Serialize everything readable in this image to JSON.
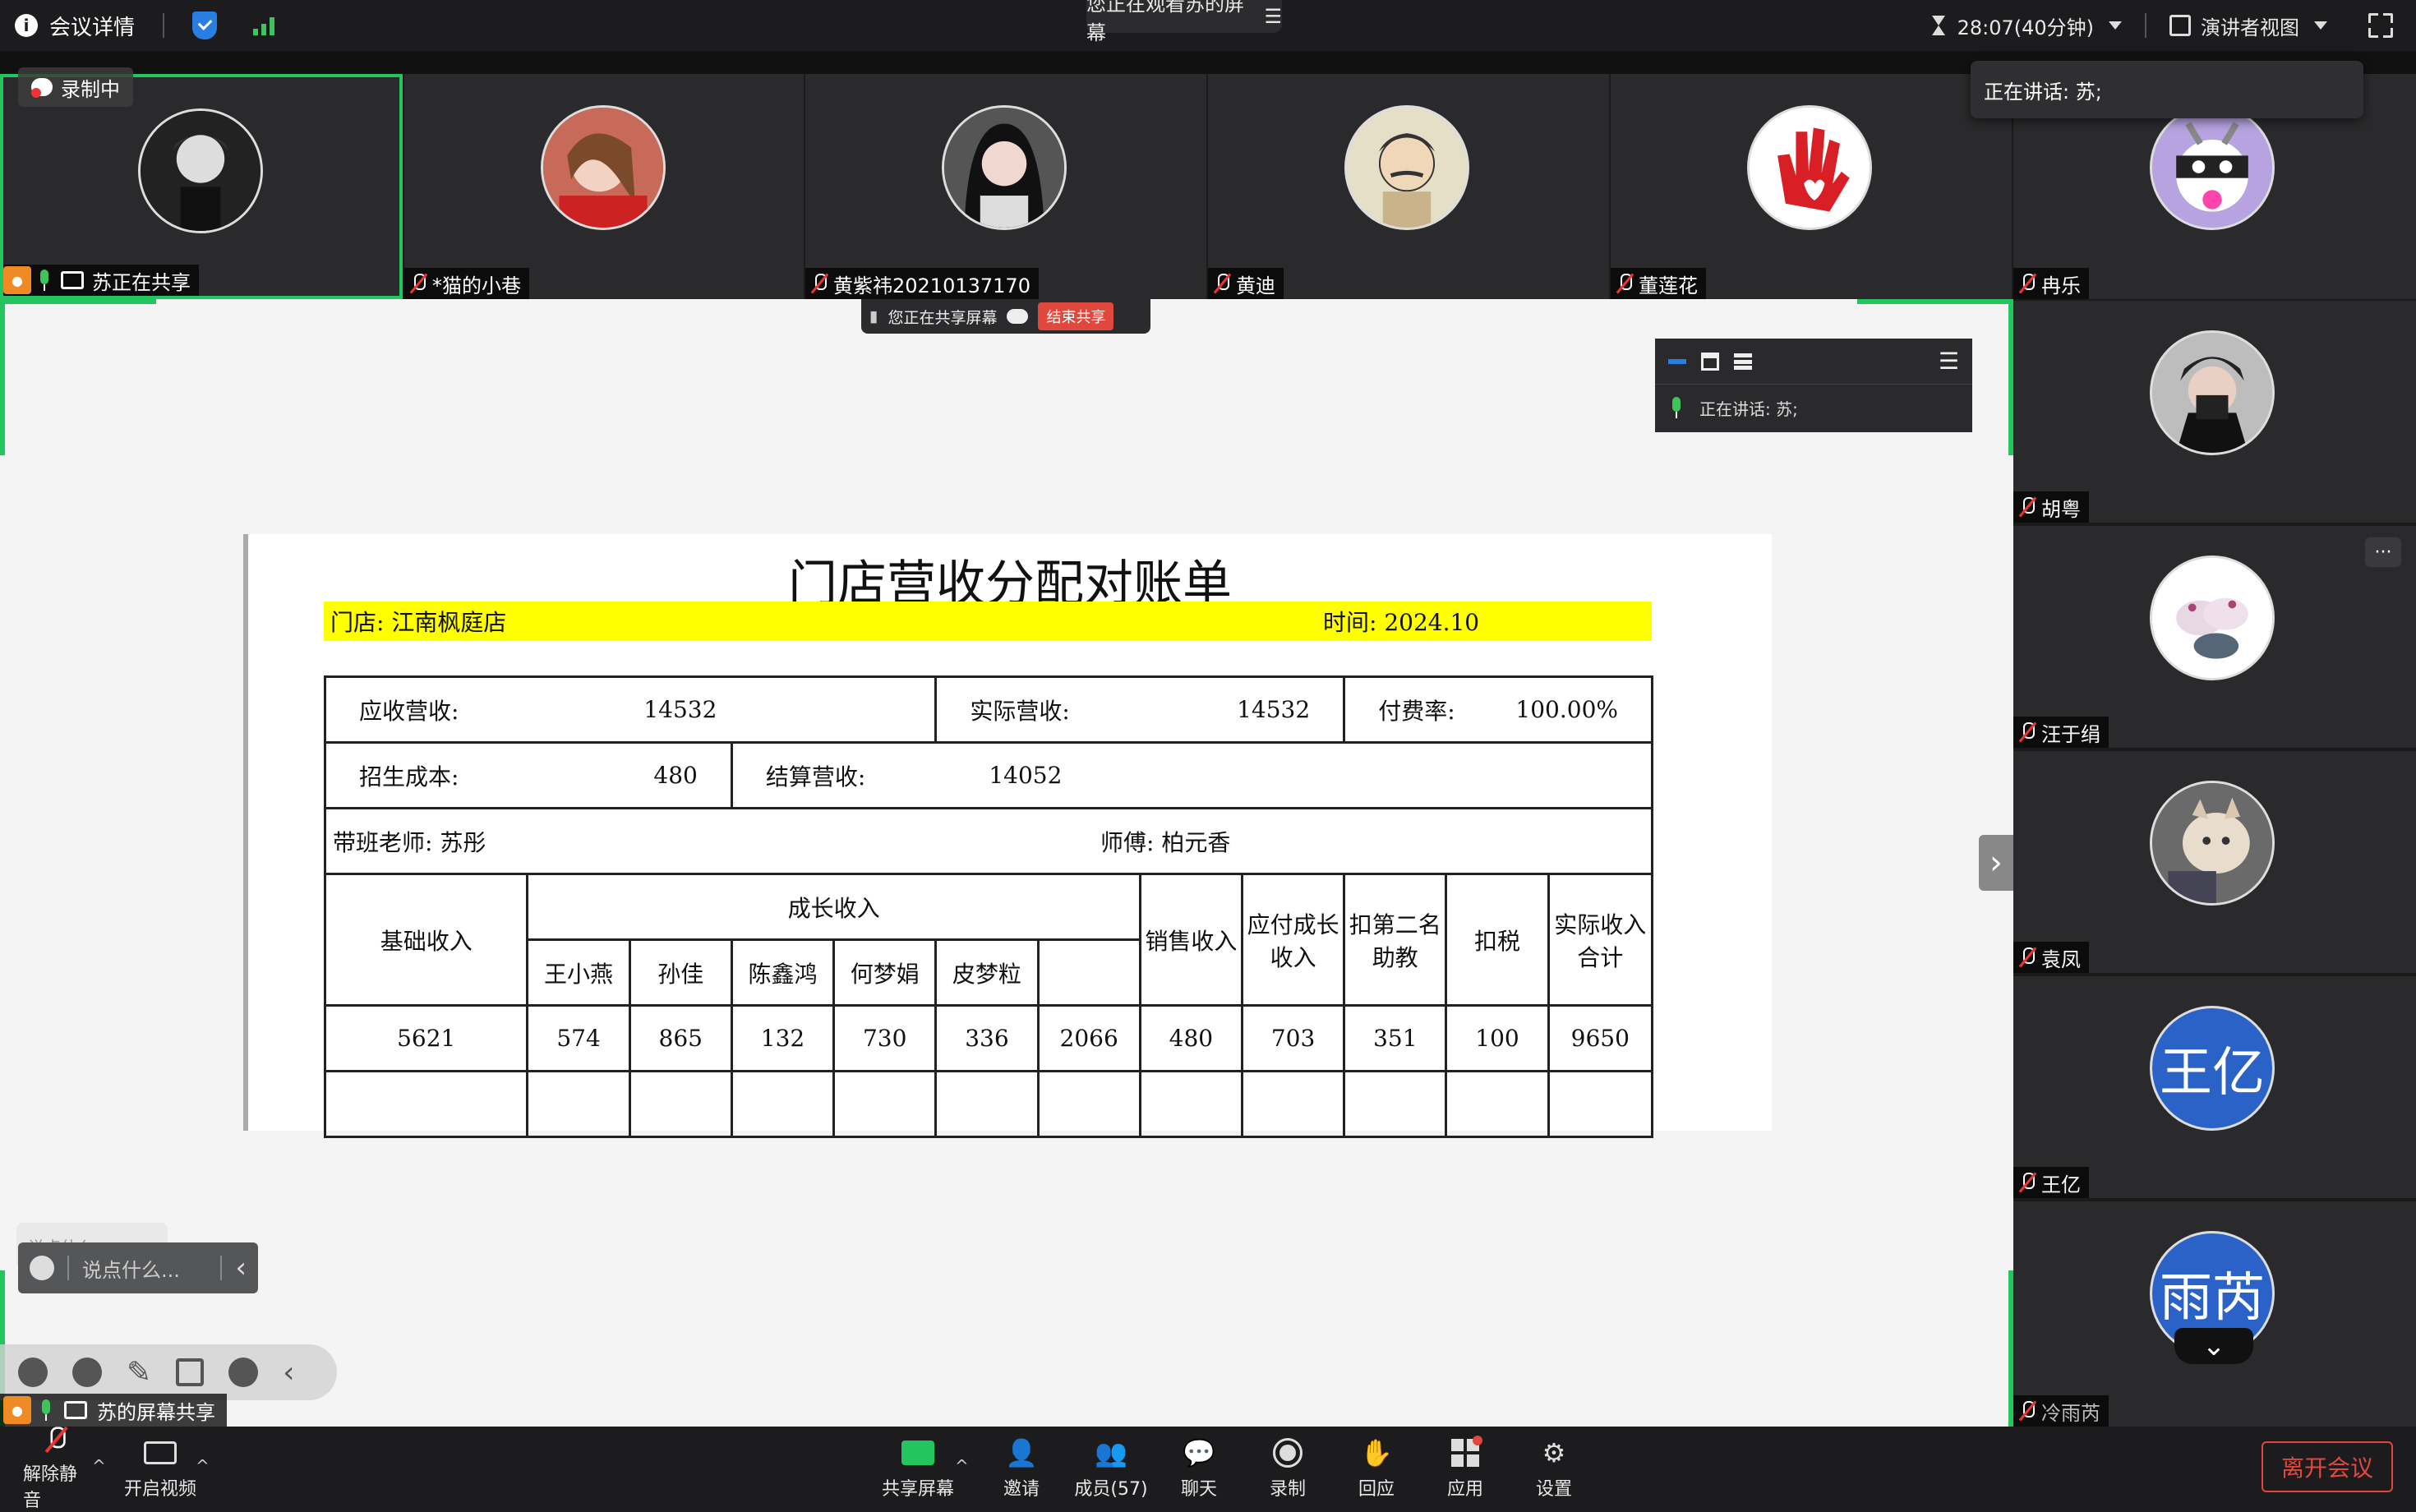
{
  "topbar": {
    "meeting_details": "会议详情",
    "viewing_label": "您正在观看苏的屏幕",
    "timer": "28:07(40分钟)",
    "view_mode": "演讲者视图"
  },
  "recording_label": "录制中",
  "speaking_popup": "正在讲话:  苏;",
  "participants_top": [
    {
      "name": "苏正在共享"
    },
    {
      "name": "*猫的小巷"
    },
    {
      "name": "黄紫祎20210137170"
    },
    {
      "name": "黄迪"
    },
    {
      "name": "董莲花"
    },
    {
      "name": "冉乐"
    }
  ],
  "participants_side": [
    {
      "name": "胡粤"
    },
    {
      "name": "汪于绢"
    },
    {
      "name": "袁凤"
    },
    {
      "name": "王亿",
      "initials": "王亿"
    },
    {
      "name": "冷雨芮",
      "initials": "雨芮"
    }
  ],
  "share_toolbar": {
    "sharing_label": "您正在共享屏幕",
    "end_share": "结束共享"
  },
  "mini_panel": {
    "speaking": "正在讲话:  苏;"
  },
  "document": {
    "title": "门店营收分配对账单",
    "store_label": "门店:  江南枫庭店",
    "time_label": "时间: 2024.10",
    "receivable_label": "应收营收:",
    "receivable_value": "14532",
    "actual_label": "实际营收:",
    "actual_value": "14532",
    "pay_rate_label": "付费率:",
    "pay_rate_value": "100.00%",
    "enroll_cost_label": "招生成本:",
    "enroll_cost_value": "480",
    "settle_label": "结算营收:",
    "settle_value": "14052",
    "teacher_label": "带班老师:   苏彤",
    "master_label": "师傅: 柏元香",
    "col_base": "基础收入",
    "col_growth": "成长收入",
    "col_sales": "销售收入",
    "col_payable": "应付成长收入",
    "col_deduct": "扣第二名助教",
    "col_tax": "扣税",
    "col_total": "实际收入合计",
    "growth_names": [
      "王小燕",
      "孙佳",
      "陈鑫鸿",
      "何梦娟",
      "皮梦粒"
    ],
    "row_values": [
      "5621",
      "574",
      "865",
      "132",
      "730",
      "336",
      "2066",
      "480",
      "703",
      "351",
      "100",
      "9650"
    ]
  },
  "chat": {
    "ghost_placeholder": "说点什么...",
    "placeholder": "说点什么..."
  },
  "self_plate": "苏的屏幕共享",
  "bottombar": {
    "unmute": "解除静音",
    "start_video": "开启视频",
    "share_screen": "共享屏幕",
    "invite": "邀请",
    "members": "成员(57)",
    "chat": "聊天",
    "record": "录制",
    "react": "回应",
    "apps": "应用",
    "settings": "设置",
    "leave": "离开会议"
  },
  "colors": {
    "accent_green": "#23c55e",
    "leave_red": "#e0483e",
    "highlight_yellow": "#ffff00",
    "avatar_blue": "#2a62c7"
  }
}
